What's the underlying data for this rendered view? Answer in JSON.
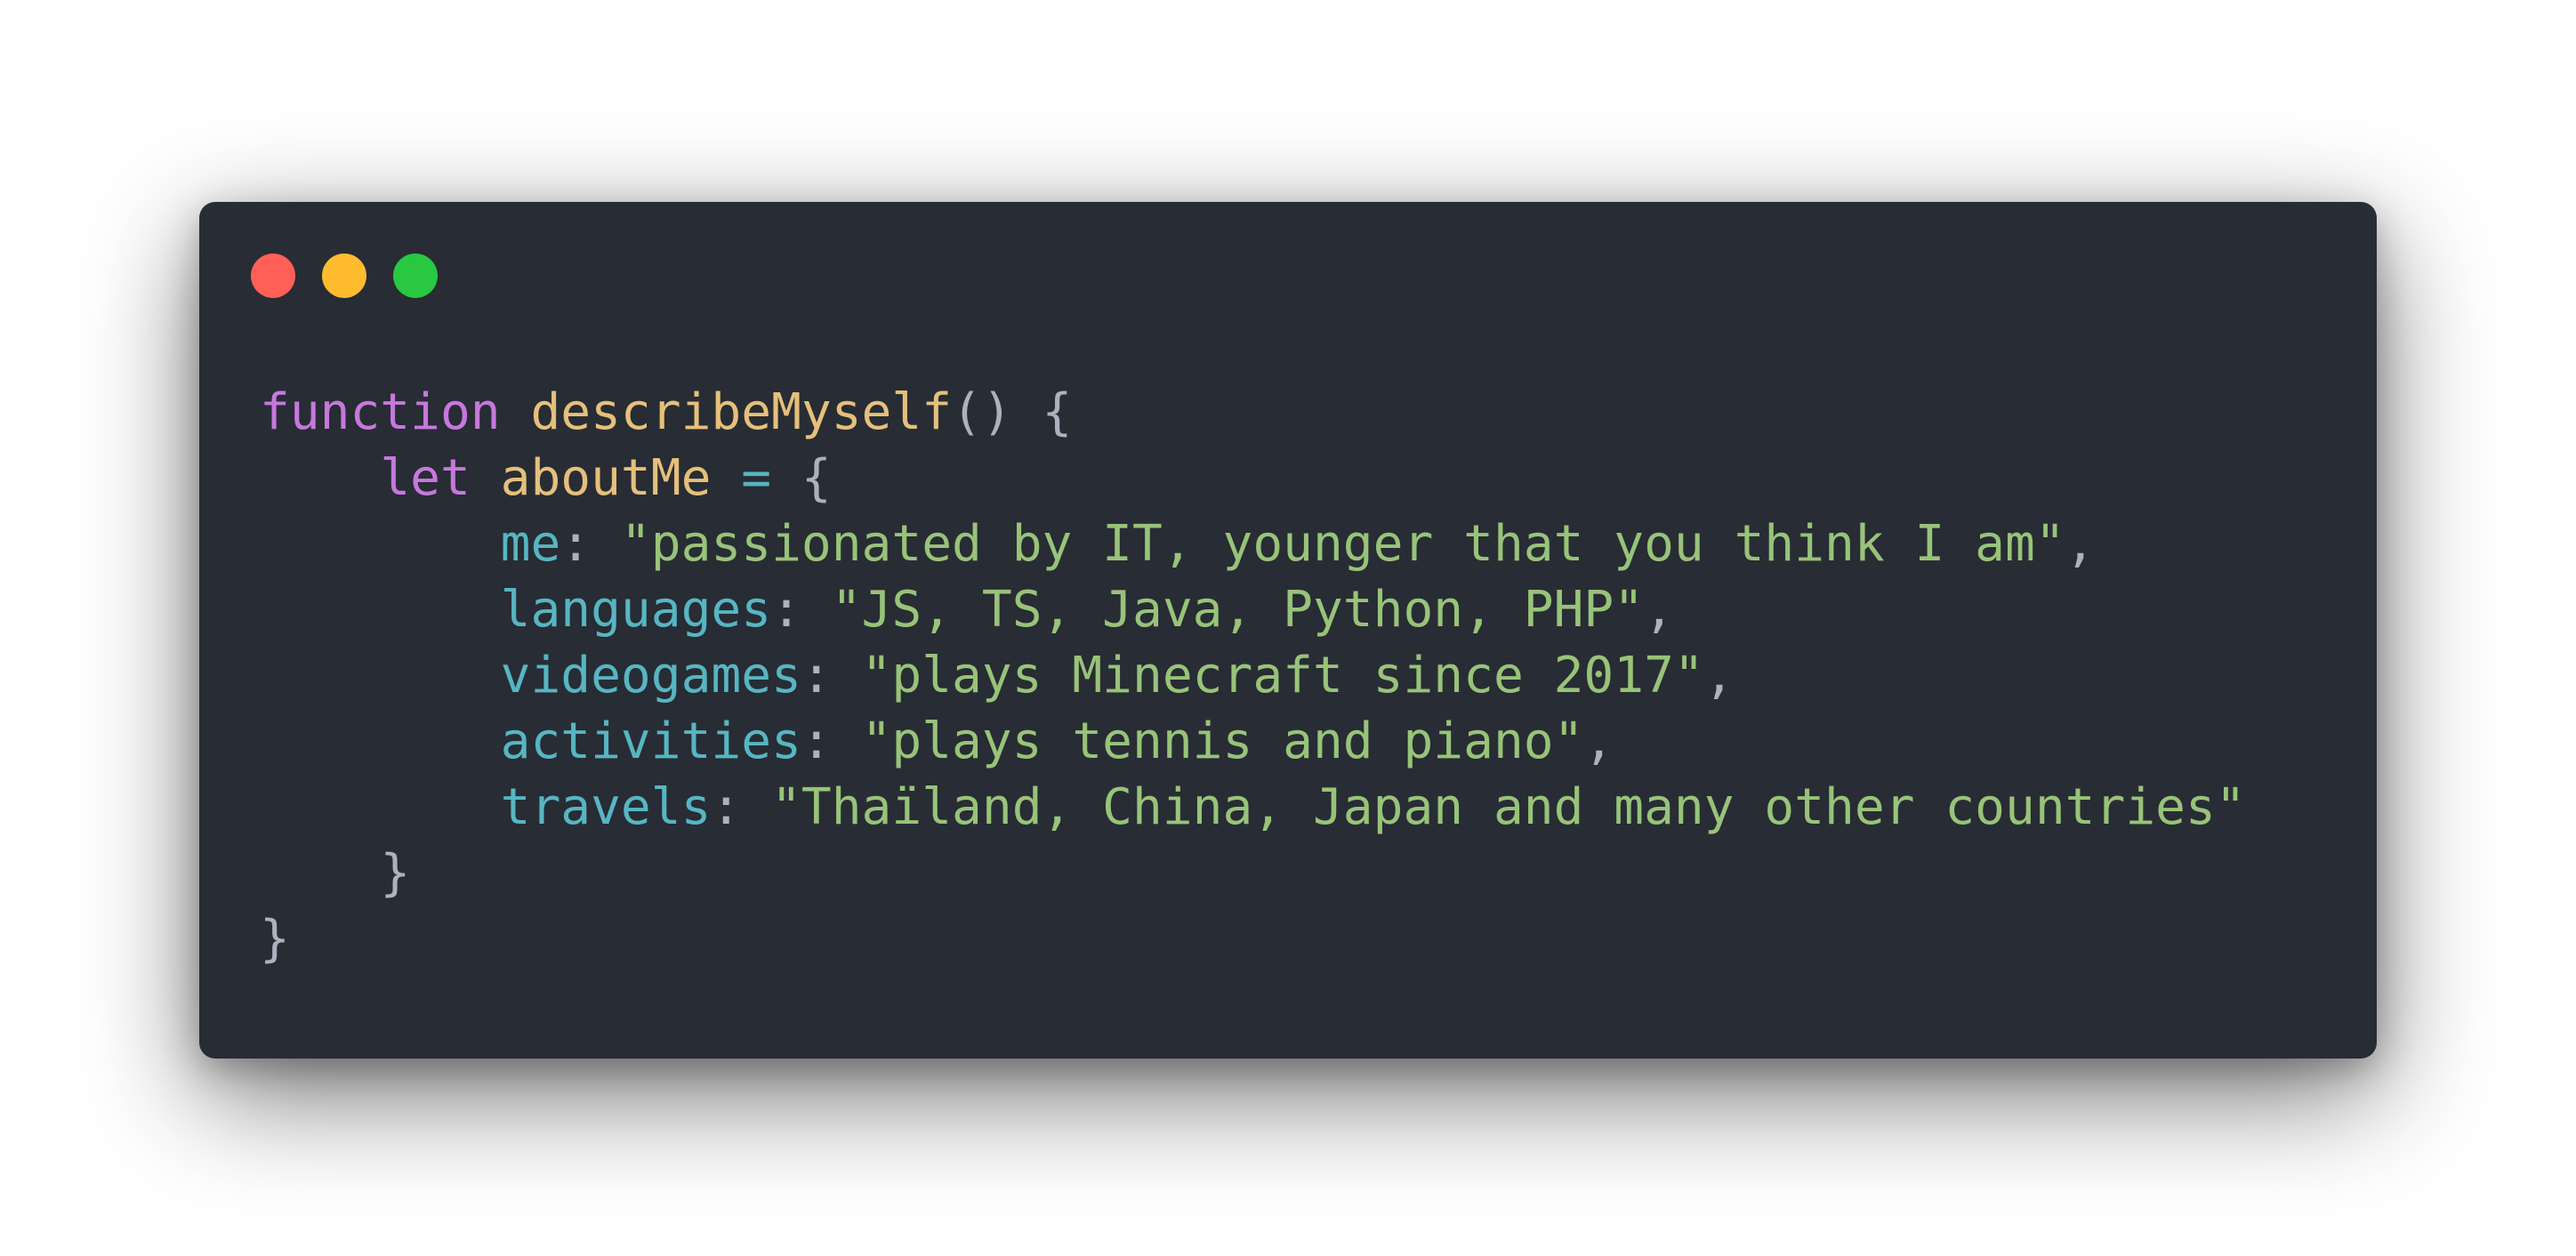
{
  "window": {
    "controls": {
      "close_color": "#ff5f57",
      "minimize_color": "#febc2e",
      "maximize_color": "#28c840"
    }
  },
  "code": {
    "language": "javascript",
    "keyword_function": "function",
    "function_name": "describeMyself",
    "params_open": "() {",
    "keyword_let": "let",
    "variable_name": "aboutMe",
    "assign_op": "=",
    "object_open": "{",
    "properties": [
      {
        "key": "me",
        "value": "\"passionated by IT, younger that you think I am\"",
        "trailing": ","
      },
      {
        "key": "languages",
        "value": "\"JS, TS, Java, Python, PHP\"",
        "trailing": ","
      },
      {
        "key": "videogames",
        "value": "\"plays Minecraft since 2017\"",
        "trailing": ","
      },
      {
        "key": "activities",
        "value": "\"plays tennis and piano\"",
        "trailing": ","
      },
      {
        "key": "travels",
        "value": "\"Thaïland, China, Japan and many other countries\"",
        "trailing": ""
      }
    ],
    "object_close": "}",
    "function_close": "}"
  }
}
